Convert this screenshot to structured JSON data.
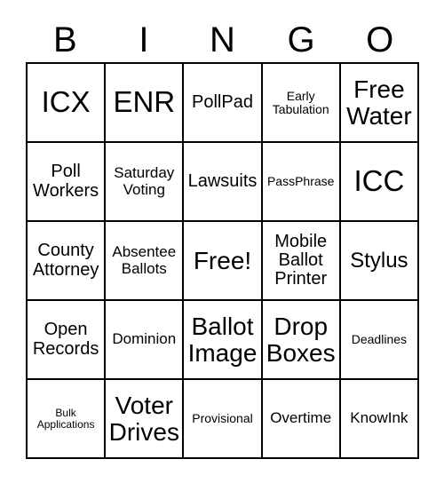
{
  "card": {
    "title": "BINGO",
    "header_letters": [
      "B",
      "I",
      "N",
      "G",
      "O"
    ],
    "columns": 5,
    "rows": 5,
    "free_space_label": "Free!",
    "border_color": "#000000",
    "background_color": "#ffffff",
    "text_color": "#000000",
    "cells": [
      {
        "text": "ICX",
        "size": "fs-xxl",
        "row": 1,
        "col": "B",
        "free": false
      },
      {
        "text": "ENR",
        "size": "fs-xxl",
        "row": 1,
        "col": "I",
        "free": false
      },
      {
        "text": "PollPad",
        "size": "fs-md",
        "row": 1,
        "col": "N",
        "free": false
      },
      {
        "text": "Early\nTabulation",
        "size": "fs-xs",
        "row": 1,
        "col": "G",
        "free": false
      },
      {
        "text": "Free\nWater",
        "size": "fs-xl",
        "row": 1,
        "col": "O",
        "free": false
      },
      {
        "text": "Poll\nWorkers",
        "size": "fs-md",
        "row": 2,
        "col": "B",
        "free": false
      },
      {
        "text": "Saturday\nVoting",
        "size": "fs-sm",
        "row": 2,
        "col": "I",
        "free": false
      },
      {
        "text": "Lawsuits",
        "size": "fs-md",
        "row": 2,
        "col": "N",
        "free": false
      },
      {
        "text": "PassPhrase",
        "size": "fs-xs",
        "row": 2,
        "col": "G",
        "free": false
      },
      {
        "text": "ICC",
        "size": "fs-xxl",
        "row": 2,
        "col": "O",
        "free": false
      },
      {
        "text": "County\nAttorney",
        "size": "fs-md",
        "row": 3,
        "col": "B",
        "free": false
      },
      {
        "text": "Absentee\nBallots",
        "size": "fs-sm",
        "row": 3,
        "col": "I",
        "free": false
      },
      {
        "text": "Free!",
        "size": "fs-xl",
        "row": 3,
        "col": "N",
        "free": true
      },
      {
        "text": "Mobile\nBallot\nPrinter",
        "size": "fs-md",
        "row": 3,
        "col": "G",
        "free": false
      },
      {
        "text": "Stylus",
        "size": "fs-lg",
        "row": 3,
        "col": "O",
        "free": false
      },
      {
        "text": "Open\nRecords",
        "size": "fs-md",
        "row": 4,
        "col": "B",
        "free": false
      },
      {
        "text": "Dominion",
        "size": "fs-sm",
        "row": 4,
        "col": "I",
        "free": false
      },
      {
        "text": "Ballot\nImage",
        "size": "fs-xl",
        "row": 4,
        "col": "N",
        "free": false
      },
      {
        "text": "Drop\nBoxes",
        "size": "fs-xl",
        "row": 4,
        "col": "G",
        "free": false
      },
      {
        "text": "Deadlines",
        "size": "fs-xs",
        "row": 4,
        "col": "O",
        "free": false
      },
      {
        "text": "Bulk\nApplications",
        "size": "fs-xxs",
        "row": 5,
        "col": "B",
        "free": false
      },
      {
        "text": "Voter\nDrives",
        "size": "fs-xl",
        "row": 5,
        "col": "I",
        "free": false
      },
      {
        "text": "Provisional",
        "size": "fs-xs",
        "row": 5,
        "col": "N",
        "free": false
      },
      {
        "text": "Overtime",
        "size": "fs-sm",
        "row": 5,
        "col": "G",
        "free": false
      },
      {
        "text": "KnowInk",
        "size": "fs-sm",
        "row": 5,
        "col": "O",
        "free": false
      }
    ]
  }
}
